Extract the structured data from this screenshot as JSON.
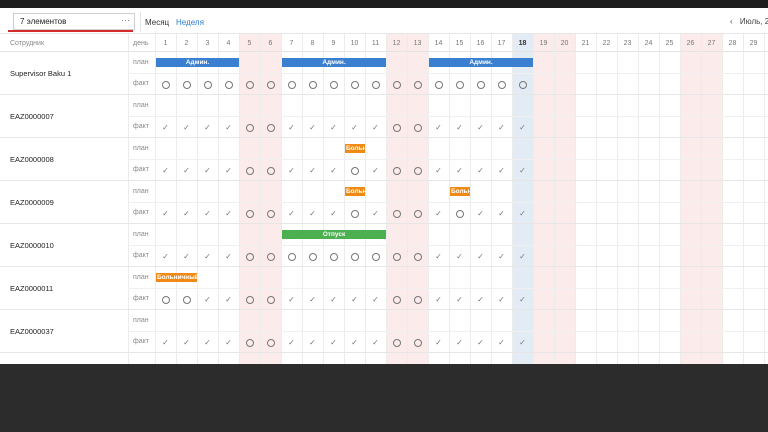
{
  "toolbar": {
    "selector_value": "7 элементов",
    "selector_more": "···",
    "tab_month": "Месяц",
    "tab_week": "Неделя",
    "nav_prev": "‹",
    "period": "Июль, 2"
  },
  "header": {
    "employee_col": "Сотрудник",
    "day_col": "день"
  },
  "days": [
    1,
    2,
    3,
    4,
    5,
    6,
    7,
    8,
    9,
    10,
    11,
    12,
    13,
    14,
    15,
    16,
    17,
    18,
    19,
    20,
    21,
    22,
    23,
    24,
    25,
    26,
    27,
    28,
    29
  ],
  "weekend_days": [
    5,
    6,
    12,
    13,
    19,
    20,
    26,
    27
  ],
  "today": 18,
  "row_labels": {
    "plan": "план",
    "fact": "факт"
  },
  "icons": {
    "circle": "absent-circle-icon",
    "check": "check-icon"
  },
  "colors": {
    "admin": "#3a7fd0",
    "sick": "#f08a14",
    "vacation": "#4caf50",
    "weekend": "#fcebeb",
    "today": "#e3ebf4",
    "accent_red": "#d42b2b"
  },
  "employees": [
    {
      "name": "Supervisor Baku 1",
      "plan": [
        {
          "start": 1,
          "end": 4,
          "label": "Админ.",
          "type": "admin"
        },
        {
          "start": 7,
          "end": 11,
          "label": "Админ.",
          "type": "admin"
        },
        {
          "start": 14,
          "end": 18,
          "label": "Админ.",
          "type": "admin"
        }
      ],
      "fact": [
        "o",
        "o",
        "o",
        "o",
        "o",
        "o",
        "o",
        "o",
        "o",
        "o",
        "o",
        "o",
        "o",
        "o",
        "o",
        "o",
        "o",
        "o"
      ]
    },
    {
      "name": "EAZ0000007",
      "plan": [],
      "fact": [
        "v",
        "v",
        "v",
        "v",
        "o",
        "o",
        "v",
        "v",
        "v",
        "v",
        "v",
        "o",
        "o",
        "v",
        "v",
        "v",
        "v",
        "v"
      ]
    },
    {
      "name": "EAZ0000008",
      "plan": [
        {
          "start": 10,
          "end": 10,
          "label": "Больничный",
          "type": "sick"
        }
      ],
      "fact": [
        "v",
        "v",
        "v",
        "v",
        "o",
        "o",
        "v",
        "v",
        "v",
        "o",
        "v",
        "o",
        "o",
        "v",
        "v",
        "v",
        "v",
        "v"
      ]
    },
    {
      "name": "EAZ0000009",
      "plan": [
        {
          "start": 10,
          "end": 10,
          "label": "Больничный",
          "type": "sick"
        },
        {
          "start": 15,
          "end": 15,
          "label": "Больничный",
          "type": "sick"
        }
      ],
      "fact": [
        "v",
        "v",
        "v",
        "v",
        "o",
        "o",
        "v",
        "v",
        "v",
        "o",
        "v",
        "o",
        "o",
        "v",
        "o",
        "v",
        "v",
        "v"
      ]
    },
    {
      "name": "EAZ0000010",
      "plan": [
        {
          "start": 7,
          "end": 11,
          "label": "Отпуск",
          "type": "vac"
        }
      ],
      "fact": [
        "v",
        "v",
        "v",
        "v",
        "o",
        "o",
        "o",
        "o",
        "o",
        "o",
        "o",
        "o",
        "o",
        "v",
        "v",
        "v",
        "v",
        "v"
      ]
    },
    {
      "name": "EAZ0000011",
      "plan": [
        {
          "start": 1,
          "end": 2,
          "label": "Больничный",
          "type": "sick"
        }
      ],
      "fact": [
        "o",
        "o",
        "v",
        "v",
        "o",
        "o",
        "v",
        "v",
        "v",
        "v",
        "v",
        "o",
        "o",
        "v",
        "v",
        "v",
        "v",
        "v"
      ]
    },
    {
      "name": "EAZ0000037",
      "plan": [],
      "fact": [
        "v",
        "v",
        "v",
        "v",
        "o",
        "o",
        "v",
        "v",
        "v",
        "v",
        "v",
        "o",
        "o",
        "v",
        "v",
        "v",
        "v",
        "v"
      ]
    }
  ]
}
